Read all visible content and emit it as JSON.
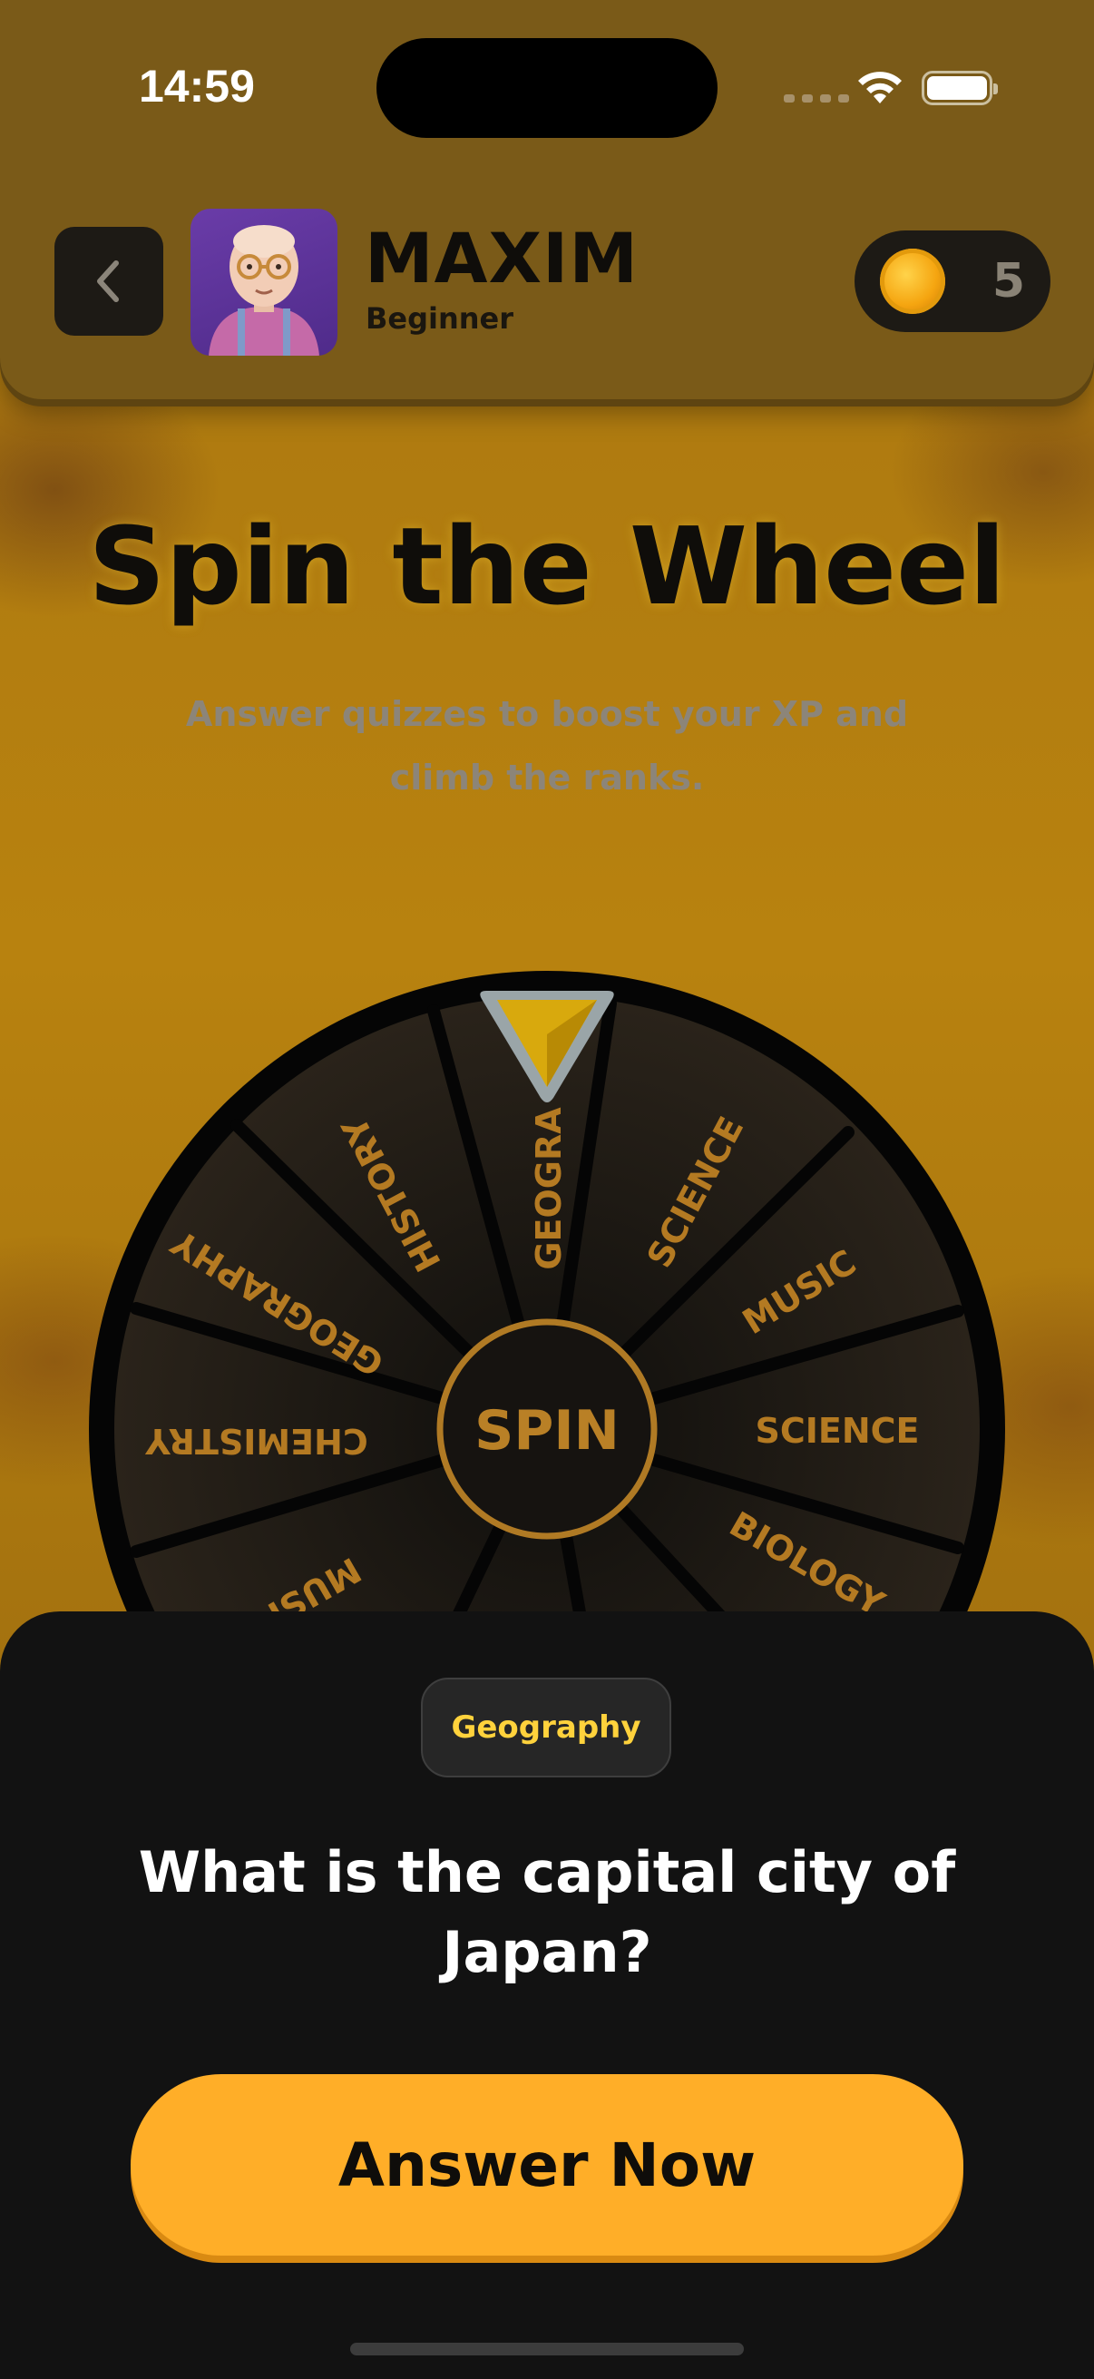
{
  "status_bar": {
    "time": "14:59"
  },
  "header": {
    "user_name": "MAXIM",
    "user_level": "Beginner",
    "coin_count": "5"
  },
  "hero": {
    "title": "Spin the Wheel",
    "subtitle": "Answer quizzes to boost your XP and climb the ranks."
  },
  "wheel": {
    "spin_label": "SPIN",
    "segments": [
      "GEOGRA",
      "SCIENCE",
      "MUSIC",
      "SCIENCE",
      "BIOLOGY",
      "",
      "",
      "MUSIC",
      "CHEMISTRY",
      "GEOGRAPHY",
      "HISTORY"
    ],
    "colors": {
      "rim": "#050505",
      "segment": "#1c1915",
      "label": "#b47a22",
      "pointer": "#d8a90d"
    }
  },
  "quiz": {
    "category": "Geography",
    "question": "What is the capital city of Japan?",
    "answer_button": "Answer Now"
  },
  "colors": {
    "accent": "#ffae28",
    "category_text": "#ffd23c",
    "header_bg": "#7a5a18"
  }
}
